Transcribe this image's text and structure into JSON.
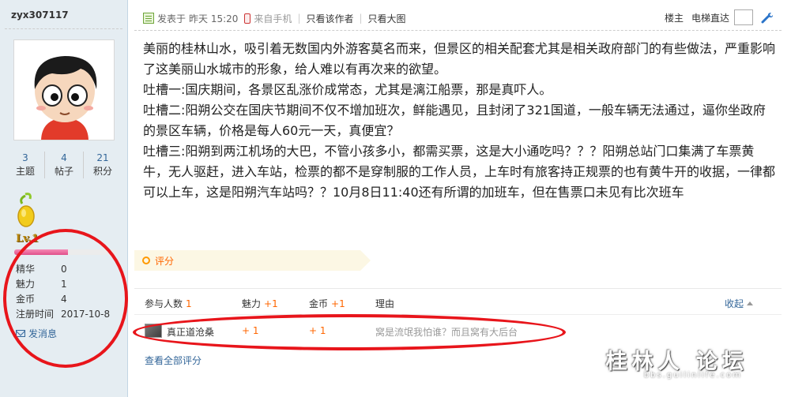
{
  "author": {
    "username": "zyx307117",
    "stats": [
      {
        "value": "3",
        "label": "主题"
      },
      {
        "value": "4",
        "label": "帖子"
      },
      {
        "value": "21",
        "label": "积分"
      }
    ],
    "level": "Lv.1",
    "level_progress": 0.52,
    "info": [
      {
        "key": "精华",
        "value": "0"
      },
      {
        "key": "魅力",
        "value": "1"
      },
      {
        "key": "金币",
        "value": "4"
      },
      {
        "key": "注册时间",
        "value": "2017-10-8"
      }
    ],
    "pm_label": "发消息"
  },
  "post_meta": {
    "posted_label": "发表于",
    "time": "昨天 15:20",
    "source": "来自手机",
    "only_author": "只看该作者",
    "only_images": "只看大图"
  },
  "floor": {
    "title": "楼主",
    "jump_label": "电梯直达"
  },
  "content": {
    "paragraphs": [
      "美丽的桂林山水，吸引着无数国内外游客莫名而来，但景区的相关配套尤其是相关政府部门的有些做法，严重影响了这美丽山水城市的形象，给人难以有再次来的欲望。",
      "吐槽一:国庆期间，各景区乱涨价成常态，尤其是漓江船票，那是真吓人。",
      "吐槽二:阳朔公交在国庆节期间不仅不增加班次，鲜能遇见，且封闭了321国道，一般车辆无法通过，逼你坐政府的景区车辆，价格是每人60元一天，真便宜？",
      "吐槽三:阳朔到两江机场的大巴，不管小孩多小，都需买票，这是大小通吃吗？？？阳朔总站门口集满了车票黄牛，无人驱赶，进入车站，检票的都不是穿制服的工作人员，上车时有旅客持正规票的也有黄牛开的收据，一律都可以上车，这是阳朔汽车站吗？？10月8日11:40还有所谓的加班车，但在售票口未见有比次班车"
    ]
  },
  "rating": {
    "title": "评分",
    "headers": {
      "participants": "参与人数",
      "participants_count": "1",
      "charm": "魅力",
      "charm_total": "+1",
      "gold": "金币",
      "gold_total": "+1",
      "reason": "理由",
      "collapse": "收起"
    },
    "rows": [
      {
        "name": "真正道沧桑",
        "charm": "+ 1",
        "gold": "+ 1",
        "reason": "窝是流氓我怕谁？而且窝有大后台"
      }
    ],
    "view_all": "查看全部评分"
  },
  "watermark": {
    "text": "桂林人 论坛",
    "sub": "bbs.guilinlife.com"
  },
  "colors": {
    "sidebar_bg": "#e5edf2",
    "link": "#336699",
    "accent_orange": "#ff6600",
    "annotation_red": "#e8151b"
  }
}
